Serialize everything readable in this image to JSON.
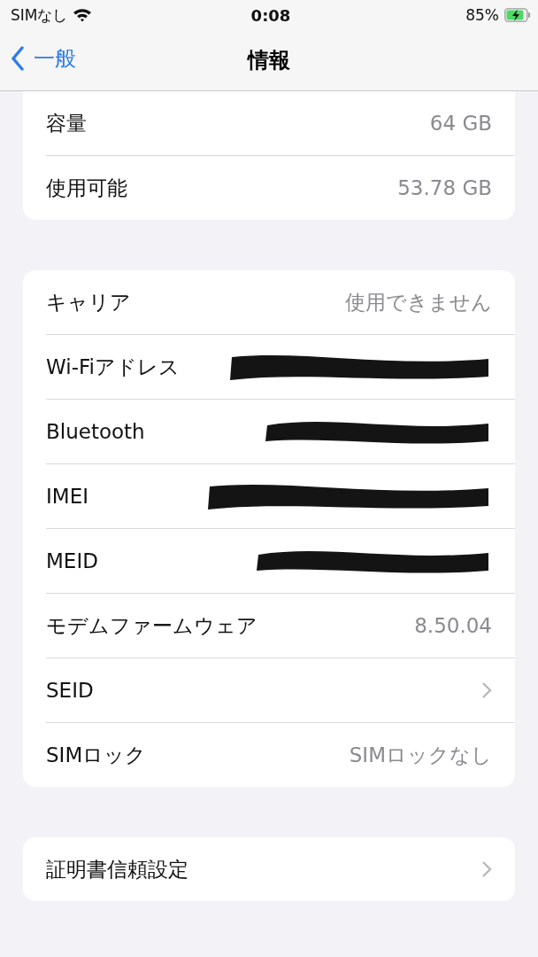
{
  "status_bar": {
    "carrier": "SIMなし",
    "time": "0:08",
    "battery": "85%"
  },
  "nav": {
    "back": "一般",
    "title": "情報"
  },
  "groups": [
    {
      "cut_top": true,
      "rows": [
        {
          "kind": "value",
          "label": "容量",
          "value": "64 GB"
        },
        {
          "kind": "value",
          "label": "使用可能",
          "value": "53.78 GB"
        }
      ]
    },
    {
      "cut_top": false,
      "rows": [
        {
          "kind": "value",
          "label": "キャリア",
          "value": "使用できません"
        },
        {
          "kind": "redacted",
          "label": "Wi-Fiアドレス"
        },
        {
          "kind": "redacted",
          "label": "Bluetooth"
        },
        {
          "kind": "redacted",
          "label": "IMEI"
        },
        {
          "kind": "redacted",
          "label": "MEID"
        },
        {
          "kind": "value",
          "label": "モデムファームウェア",
          "value": "8.50.04"
        },
        {
          "kind": "chevron",
          "label": "SEID"
        },
        {
          "kind": "value",
          "label": "SIMロック",
          "value": "SIMロックなし"
        }
      ]
    },
    {
      "cut_top": false,
      "rows": [
        {
          "kind": "chevron",
          "label": "証明書信頼設定"
        }
      ]
    }
  ]
}
